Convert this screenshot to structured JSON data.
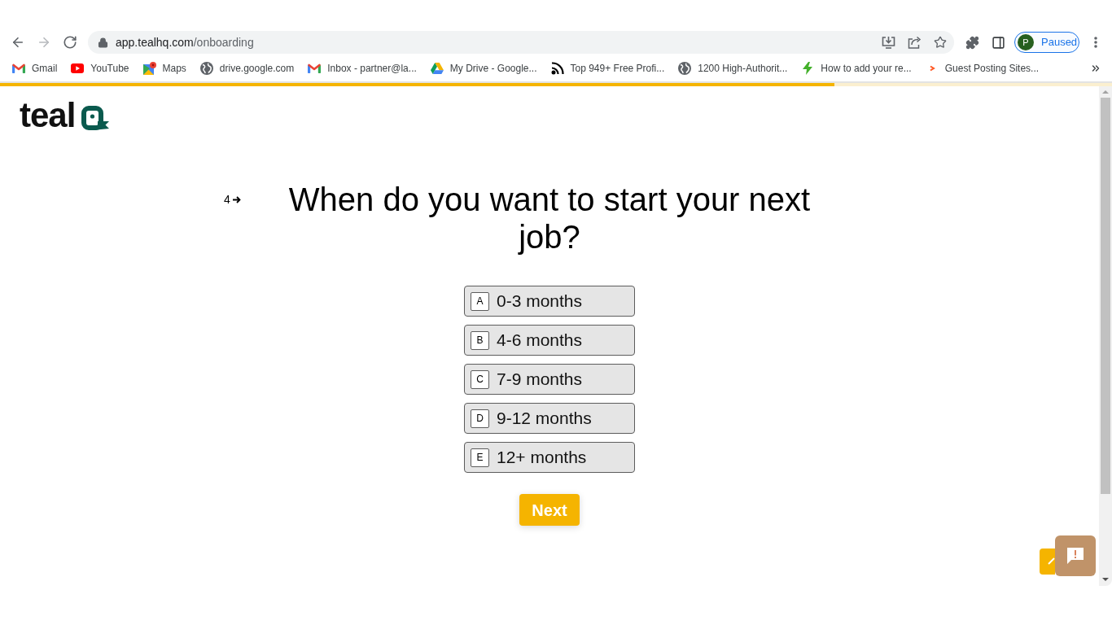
{
  "browser": {
    "nav_buttons": [
      {
        "kind": "back",
        "disabled": false
      },
      {
        "kind": "forward",
        "disabled": true
      },
      {
        "kind": "reload",
        "disabled": false
      }
    ],
    "address": {
      "host": "app.tealhq.com",
      "path": "/onboarding"
    },
    "profile": {
      "initial": "P",
      "status": "Paused"
    },
    "bookmarks": [
      {
        "kind": "gmail",
        "label": "Gmail"
      },
      {
        "kind": "youtube",
        "label": "YouTube"
      },
      {
        "kind": "maps",
        "label": "Maps"
      },
      {
        "kind": "globe",
        "label": "drive.google.com"
      },
      {
        "kind": "gmail",
        "label": "Inbox - partner@la..."
      },
      {
        "kind": "drive",
        "label": "My Drive - Google..."
      },
      {
        "kind": "arcs",
        "label": "Top 949+ Free Profi..."
      },
      {
        "kind": "globe",
        "label": "1200 High-Authorit..."
      },
      {
        "kind": "bolt",
        "label": "How to add your re..."
      },
      {
        "kind": "chevron",
        "label": "Guest Posting Sites..."
      }
    ]
  },
  "page": {
    "progress": {
      "level": 0.75
    },
    "logo": {
      "text": "teal"
    },
    "question": {
      "number": "4",
      "text": "When do you want to start your next job?"
    },
    "options": [
      {
        "key": "A",
        "label": "0-3 months",
        "selected": false
      },
      {
        "key": "B",
        "label": "4-6 months",
        "selected": false
      },
      {
        "key": "C",
        "label": "7-9 months",
        "selected": false
      },
      {
        "key": "D",
        "label": "9-12 months",
        "selected": false
      },
      {
        "key": "E",
        "label": "12+ months",
        "selected": false
      }
    ],
    "next_button": {
      "label": "Next"
    }
  }
}
